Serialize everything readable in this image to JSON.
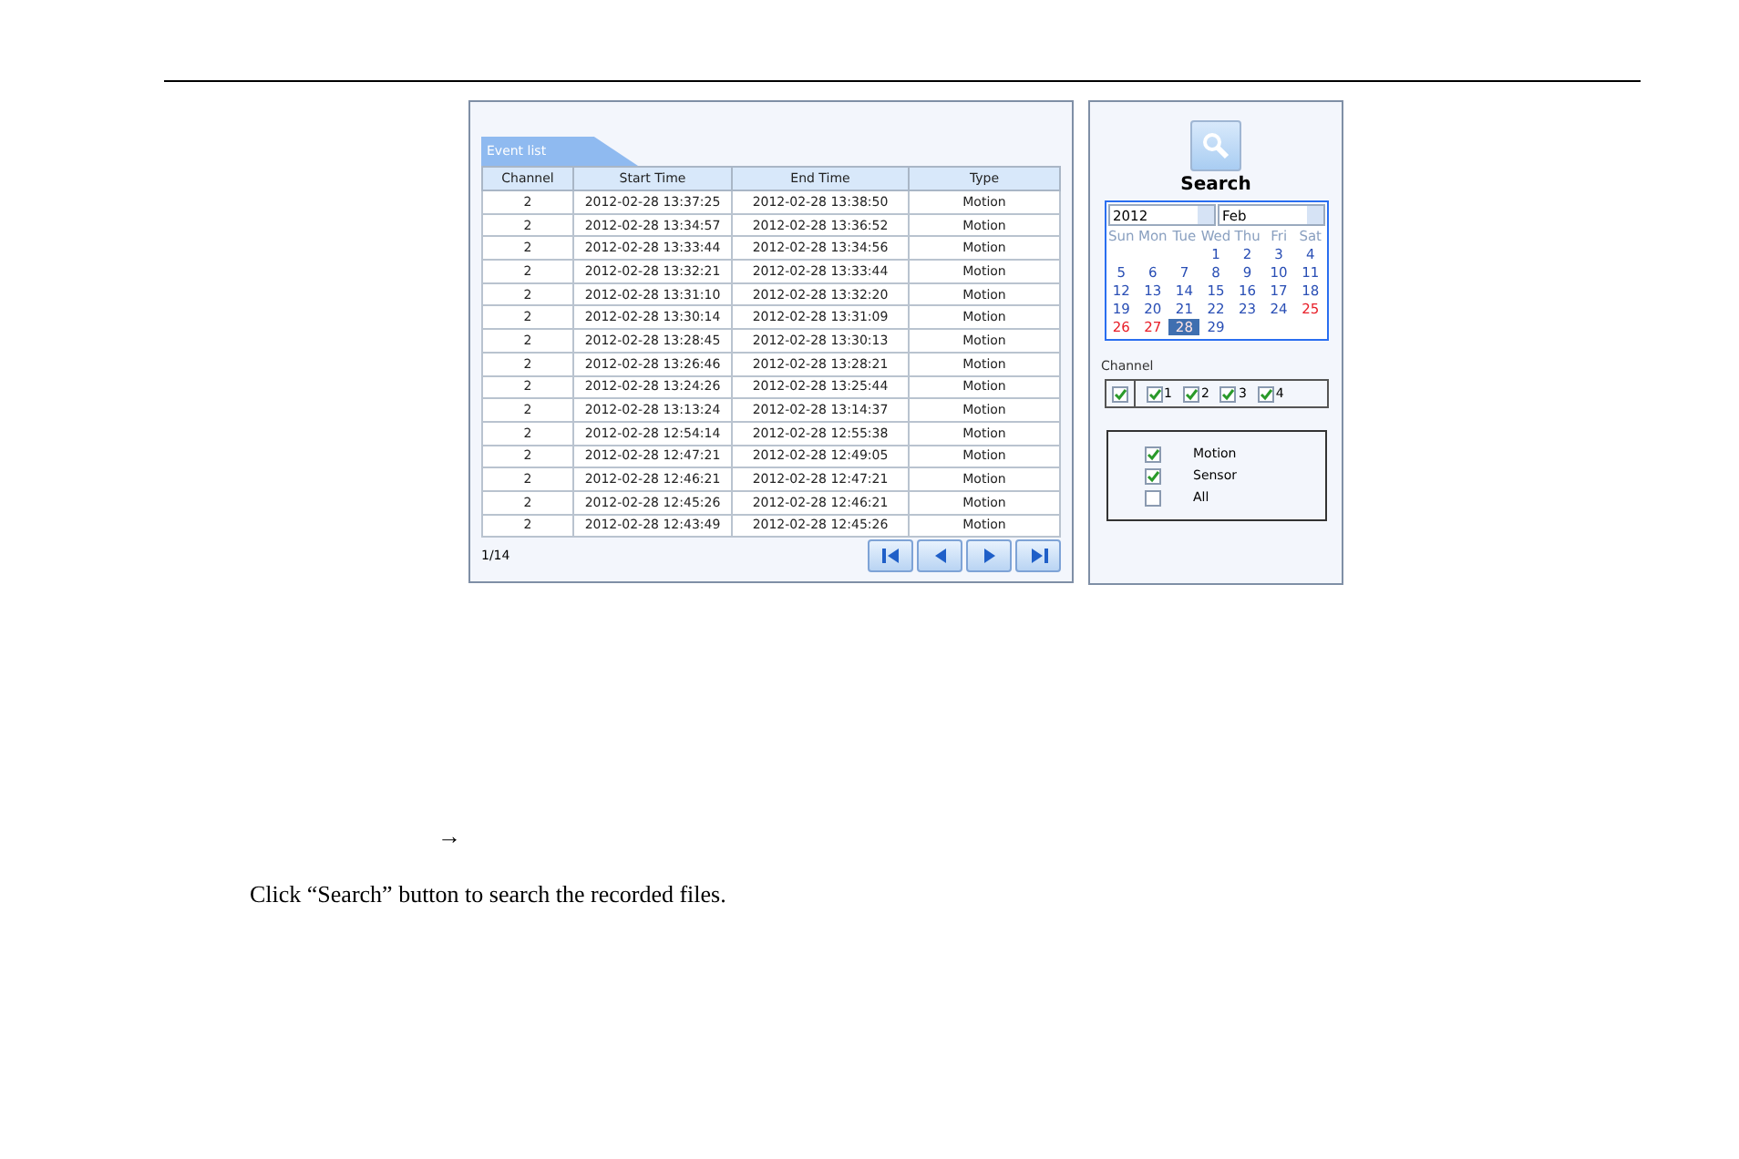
{
  "event_list": {
    "tab": "Event list",
    "columns": [
      "Channel",
      "Start Time",
      "End Time",
      "Type"
    ],
    "rows": [
      [
        "2",
        "2012-02-28 13:37:25",
        "2012-02-28 13:38:50",
        "Motion"
      ],
      [
        "2",
        "2012-02-28 13:34:57",
        "2012-02-28 13:36:52",
        "Motion"
      ],
      [
        "2",
        "2012-02-28 13:33:44",
        "2012-02-28 13:34:56",
        "Motion"
      ],
      [
        "2",
        "2012-02-28 13:32:21",
        "2012-02-28 13:33:44",
        "Motion"
      ],
      [
        "2",
        "2012-02-28 13:31:10",
        "2012-02-28 13:32:20",
        "Motion"
      ],
      [
        "2",
        "2012-02-28 13:30:14",
        "2012-02-28 13:31:09",
        "Motion"
      ],
      [
        "2",
        "2012-02-28 13:28:45",
        "2012-02-28 13:30:13",
        "Motion"
      ],
      [
        "2",
        "2012-02-28 13:26:46",
        "2012-02-28 13:28:21",
        "Motion"
      ],
      [
        "2",
        "2012-02-28 13:24:26",
        "2012-02-28 13:25:44",
        "Motion"
      ],
      [
        "2",
        "2012-02-28 13:13:24",
        "2012-02-28 13:14:37",
        "Motion"
      ],
      [
        "2",
        "2012-02-28 12:54:14",
        "2012-02-28 12:55:38",
        "Motion"
      ],
      [
        "2",
        "2012-02-28 12:47:21",
        "2012-02-28 12:49:05",
        "Motion"
      ],
      [
        "2",
        "2012-02-28 12:46:21",
        "2012-02-28 12:47:21",
        "Motion"
      ],
      [
        "2",
        "2012-02-28 12:45:26",
        "2012-02-28 12:46:21",
        "Motion"
      ],
      [
        "2",
        "2012-02-28 12:43:49",
        "2012-02-28 12:45:26",
        "Motion"
      ]
    ],
    "page": "1/14"
  },
  "search": {
    "button": "Search",
    "year": "2012",
    "month": "Feb",
    "weekdays": [
      "Sun",
      "Mon",
      "Tue",
      "Wed",
      "Thu",
      "Fri",
      "Sat"
    ],
    "weeks": [
      [
        {
          "day": "1",
          "marked": false,
          "selected": false
        },
        {
          "day": "2",
          "marked": false,
          "selected": false
        },
        {
          "day": "3",
          "marked": false,
          "selected": false
        },
        {
          "day": "4",
          "marked": false,
          "selected": false
        }
      ],
      [
        {
          "day": "5",
          "marked": false,
          "selected": false
        },
        {
          "day": "6",
          "marked": false,
          "selected": false
        },
        {
          "day": "7",
          "marked": false,
          "selected": false
        },
        {
          "day": "8",
          "marked": false,
          "selected": false
        },
        {
          "day": "9",
          "marked": false,
          "selected": false
        },
        {
          "day": "10",
          "marked": false,
          "selected": false
        },
        {
          "day": "11",
          "marked": false,
          "selected": false
        }
      ],
      [
        {
          "day": "12",
          "marked": false,
          "selected": false
        },
        {
          "day": "13",
          "marked": false,
          "selected": false
        },
        {
          "day": "14",
          "marked": false,
          "selected": false
        },
        {
          "day": "15",
          "marked": false,
          "selected": false
        },
        {
          "day": "16",
          "marked": false,
          "selected": false
        },
        {
          "day": "17",
          "marked": false,
          "selected": false
        },
        {
          "day": "18",
          "marked": false,
          "selected": false
        }
      ],
      [
        {
          "day": "19",
          "marked": false,
          "selected": false
        },
        {
          "day": "20",
          "marked": false,
          "selected": false
        },
        {
          "day": "21",
          "marked": false,
          "selected": false
        },
        {
          "day": "22",
          "marked": false,
          "selected": false
        },
        {
          "day": "23",
          "marked": false,
          "selected": false
        },
        {
          "day": "24",
          "marked": false,
          "selected": false
        },
        {
          "day": "25",
          "marked": true,
          "selected": false
        }
      ],
      [
        {
          "day": "26",
          "marked": true,
          "selected": false
        },
        {
          "day": "27",
          "marked": true,
          "selected": false
        },
        {
          "day": "28",
          "marked": true,
          "selected": true
        },
        {
          "day": "29",
          "marked": false,
          "selected": false
        }
      ]
    ],
    "channel_label": "Channel",
    "all_channels_checked": true,
    "channels": [
      {
        "label": "1",
        "checked": true
      },
      {
        "label": "2",
        "checked": true
      },
      {
        "label": "3",
        "checked": true
      },
      {
        "label": "4",
        "checked": true
      }
    ],
    "types": [
      {
        "label": "Motion",
        "checked": true
      },
      {
        "label": "Sensor",
        "checked": true
      },
      {
        "label": "All",
        "checked": false
      }
    ]
  },
  "body": {
    "arrow": "→",
    "instruction": "Click “Search” button to search the recorded files."
  }
}
